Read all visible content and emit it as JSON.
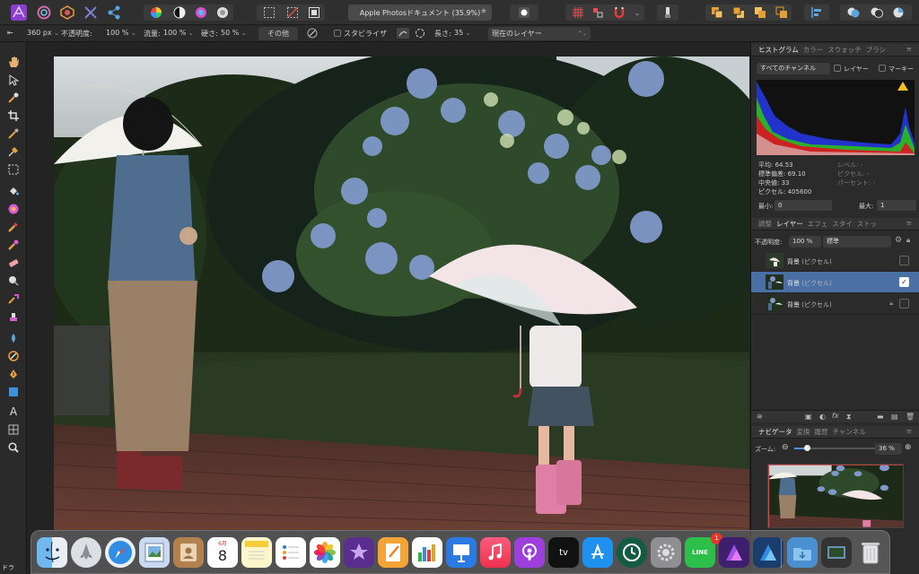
{
  "toolbar": {
    "doc_title": "Apple Photosドキュメント (35.9%)",
    "star": "★"
  },
  "context_bar": {
    "width_value": "360 px",
    "opacity_label": "不透明度:",
    "opacity_value": "100 %",
    "flow_label": "流量:",
    "flow_value": "100 %",
    "hardness_label": "硬さ:",
    "hardness_value": "50 %",
    "other_button": "その他",
    "stabilizer_label": "スタビライザ",
    "length_label": "長さ:",
    "length_value": "35",
    "layer_select": "現在のレイヤー"
  },
  "histogram_panel": {
    "tabs": [
      "ヒストグラム",
      "カラー",
      "スウォッチ",
      "ブラシ"
    ],
    "channel_select": "すべてのチャンネル",
    "layer_checkbox": "レイヤー",
    "marker_checkbox": "マーキー",
    "stats": {
      "mean_label": "平均:",
      "mean_value": "64.53",
      "stddev_label": "標準偏差:",
      "stddev_value": "69.10",
      "median_label": "中央値:",
      "median_value": "33",
      "pixels_label": "ピクセル:",
      "pixels_value": "405600",
      "level_label": "レベル:",
      "level_value": "-",
      "pixel_label": "ピクセル:",
      "pixel_value": "-",
      "percentile_label": "パーセント:",
      "percentile_value": "-"
    },
    "min_label": "最小:",
    "min_value": "0",
    "max_label": "最大:",
    "max_value": "1"
  },
  "layers_panel": {
    "tabs": [
      "調整",
      "レイヤー",
      "エフェ",
      "スタイ",
      "ストッ"
    ],
    "opacity_label": "不透明度:",
    "opacity_value": "100 %",
    "blend_mode": "標準",
    "layers": [
      {
        "name": "背景",
        "type": "(ピクセル)"
      },
      {
        "name": "背景",
        "type": "(ピクセル)"
      },
      {
        "name": "背景",
        "type": "(ピクセル)"
      }
    ]
  },
  "navigator_panel": {
    "tabs": [
      "ナビゲータ",
      "変換",
      "履歴",
      "チャンネル"
    ],
    "zoom_label": "ズーム:",
    "zoom_value": "36 %"
  },
  "dock": {
    "calendar_month": "6月",
    "calendar_day": "8",
    "line_badge": "1",
    "tv_label": "tv",
    "line_label": "LINE"
  },
  "bottom_left_label": "ドラ",
  "colors": {
    "selection": "#4a6fa5",
    "panel_bg": "#2b2b2b",
    "toolbar_bg": "#2f2f2f"
  }
}
